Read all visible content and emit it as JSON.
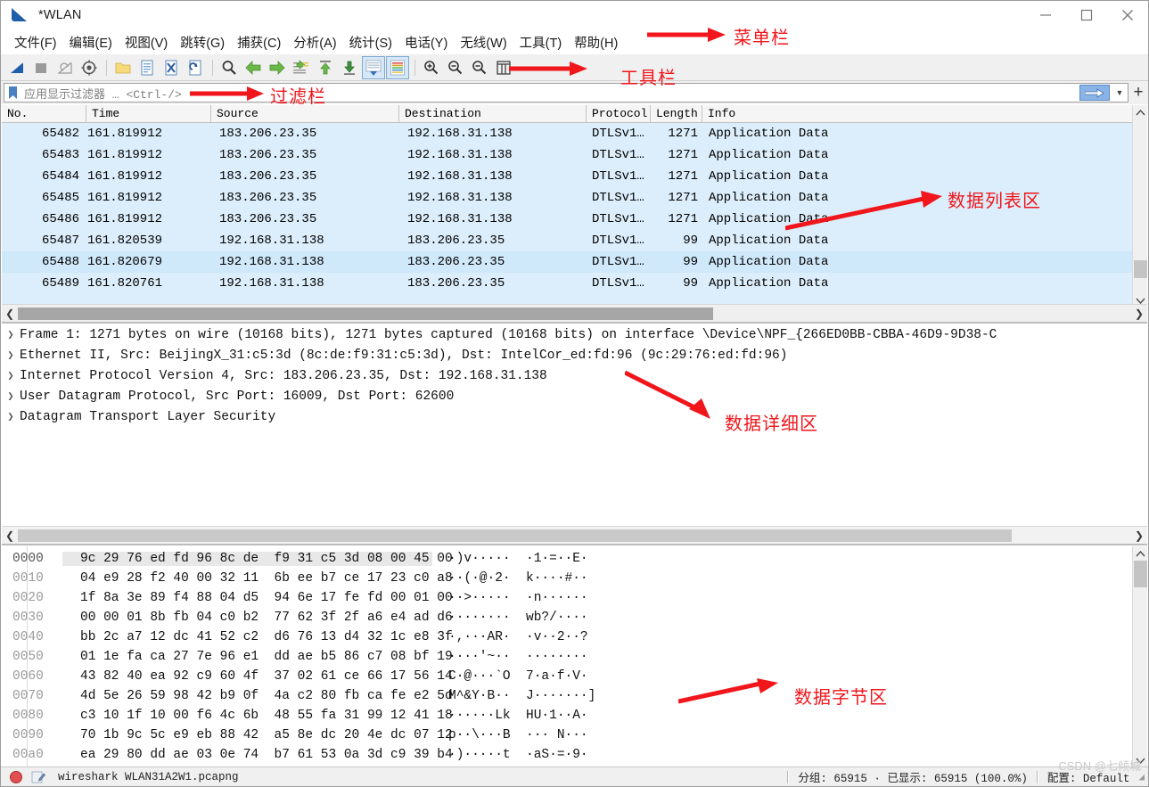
{
  "window": {
    "title": "*WLAN",
    "app_icon": "wireshark-fin-icon",
    "minimize": "minimize-icon",
    "maximize": "maximize-icon",
    "close": "close-icon"
  },
  "menu": {
    "items": [
      {
        "label": "文件(F)"
      },
      {
        "label": "编辑(E)"
      },
      {
        "label": "视图(V)"
      },
      {
        "label": "跳转(G)"
      },
      {
        "label": "捕获(C)"
      },
      {
        "label": "分析(A)"
      },
      {
        "label": "统计(S)"
      },
      {
        "label": "电话(Y)"
      },
      {
        "label": "无线(W)"
      },
      {
        "label": "工具(T)"
      },
      {
        "label": "帮助(H)"
      }
    ]
  },
  "toolbar": {
    "buttons": [
      {
        "name": "start-capture-icon"
      },
      {
        "name": "stop-capture-icon"
      },
      {
        "name": "restart-capture-icon"
      },
      {
        "name": "capture-options-icon"
      },
      {
        "name": "open-file-icon"
      },
      {
        "name": "save-file-icon"
      },
      {
        "name": "close-file-icon"
      },
      {
        "name": "reload-file-icon"
      },
      {
        "name": "find-packet-icon"
      },
      {
        "name": "go-back-icon"
      },
      {
        "name": "go-forward-icon"
      },
      {
        "name": "go-to-packet-icon"
      },
      {
        "name": "go-to-first-icon"
      },
      {
        "name": "go-to-last-icon"
      },
      {
        "name": "auto-scroll-icon"
      },
      {
        "name": "colorize-icon"
      },
      {
        "name": "zoom-in-icon"
      },
      {
        "name": "zoom-out-icon"
      },
      {
        "name": "zoom-reset-icon"
      },
      {
        "name": "resize-columns-icon"
      }
    ]
  },
  "filter": {
    "bookmark_icon": "bookmark-icon",
    "placeholder": "应用显示过滤器 … <Ctrl-/>",
    "value": "",
    "apply_icon": "apply-filter-arrow-icon",
    "dropdown_icon": "chevron-down-icon",
    "add_icon": "plus-icon"
  },
  "packet_list": {
    "columns": [
      "No.",
      "Time",
      "Source",
      "Destination",
      "Protocol",
      "Length",
      "Info"
    ],
    "rows": [
      {
        "no": "65482",
        "time": "161.819912",
        "source": "183.206.23.35",
        "destination": "192.168.31.138",
        "protocol": "DTLSv1…",
        "length": "1271",
        "info": "Application Data",
        "selected": false
      },
      {
        "no": "65483",
        "time": "161.819912",
        "source": "183.206.23.35",
        "destination": "192.168.31.138",
        "protocol": "DTLSv1…",
        "length": "1271",
        "info": "Application Data",
        "selected": false
      },
      {
        "no": "65484",
        "time": "161.819912",
        "source": "183.206.23.35",
        "destination": "192.168.31.138",
        "protocol": "DTLSv1…",
        "length": "1271",
        "info": "Application Data",
        "selected": false
      },
      {
        "no": "65485",
        "time": "161.819912",
        "source": "183.206.23.35",
        "destination": "192.168.31.138",
        "protocol": "DTLSv1…",
        "length": "1271",
        "info": "Application Data",
        "selected": false
      },
      {
        "no": "65486",
        "time": "161.819912",
        "source": "183.206.23.35",
        "destination": "192.168.31.138",
        "protocol": "DTLSv1…",
        "length": "1271",
        "info": "Application Data",
        "selected": false
      },
      {
        "no": "65487",
        "time": "161.820539",
        "source": "192.168.31.138",
        "destination": "183.206.23.35",
        "protocol": "DTLSv1…",
        "length": "99",
        "info": "Application Data",
        "selected": false
      },
      {
        "no": "65488",
        "time": "161.820679",
        "source": "192.168.31.138",
        "destination": "183.206.23.35",
        "protocol": "DTLSv1…",
        "length": "99",
        "info": "Application Data",
        "selected": true
      },
      {
        "no": "65489",
        "time": "161.820761",
        "source": "192.168.31.138",
        "destination": "183.206.23.35",
        "protocol": "DTLSv1…",
        "length": "99",
        "info": "Application Data",
        "selected": false
      }
    ]
  },
  "packet_details": {
    "rows": [
      {
        "text": "Frame 1: 1271 bytes on wire (10168 bits), 1271 bytes captured (10168 bits) on interface \\Device\\NPF_{266ED0BB-CBBA-46D9-9D38-C"
      },
      {
        "text": "Ethernet II, Src: BeijingX_31:c5:3d (8c:de:f9:31:c5:3d), Dst: IntelCor_ed:fd:96 (9c:29:76:ed:fd:96)"
      },
      {
        "text": "Internet Protocol Version 4, Src: 183.206.23.35, Dst: 192.168.31.138"
      },
      {
        "text": "User Datagram Protocol, Src Port: 16009, Dst Port: 62600"
      },
      {
        "text": "Datagram Transport Layer Security"
      }
    ]
  },
  "hex_dump": {
    "rows": [
      {
        "offset": "0000",
        "bytes": "9c 29 76 ed fd 96 8c de  f9 31 c5 3d 08 00 45 00",
        "ascii": "·)v·····  ·1·=··E·"
      },
      {
        "offset": "0010",
        "bytes": "04 e9 28 f2 40 00 32 11  6b ee b7 ce 17 23 c0 a8",
        "ascii": "··(·@·2·  k····#··"
      },
      {
        "offset": "0020",
        "bytes": "1f 8a 3e 89 f4 88 04 d5  94 6e 17 fe fd 00 01 00",
        "ascii": "··>·····  ·n······"
      },
      {
        "offset": "0030",
        "bytes": "00 00 01 8b fb 04 c0 b2  77 62 3f 2f a6 e4 ad d6",
        "ascii": "········  wb?/····"
      },
      {
        "offset": "0040",
        "bytes": "bb 2c a7 12 dc 41 52 c2  d6 76 13 d4 32 1c e8 3f",
        "ascii": "·,···AR·  ·v··2··?"
      },
      {
        "offset": "0050",
        "bytes": "01 1e fa ca 27 7e 96 e1  dd ae b5 86 c7 08 bf 19",
        "ascii": "····'~··  ········"
      },
      {
        "offset": "0060",
        "bytes": "43 82 40 ea 92 c9 60 4f  37 02 61 ce 66 17 56 14",
        "ascii": "C·@···`O  7·a·f·V·"
      },
      {
        "offset": "0070",
        "bytes": "4d 5e 26 59 98 42 b9 0f  4a c2 80 fb ca fe e2 5d",
        "ascii": "M^&Y·B··  J·······]"
      },
      {
        "offset": "0080",
        "bytes": "c3 10 1f 10 00 f6 4c 6b  48 55 fa 31 99 12 41 18",
        "ascii": "······Lk  HU·1··A·"
      },
      {
        "offset": "0090",
        "bytes": "70 1b 9c 5c e9 eb 88 42  a5 8e dc 20 4e dc 07 12",
        "ascii": "p··\\···B  ··· N···"
      },
      {
        "offset": "00a0",
        "bytes": "ea 29 80 dd ae 03 0e 74  b7 61 53 0a 3d c9 39 b4",
        "ascii": "·)·····t  ·aS·=·9·"
      }
    ]
  },
  "status_bar": {
    "record_icon": "record-dot-icon",
    "edit_icon": "edit-comment-icon",
    "file_name": "wireshark WLAN31A2W1.pcapng",
    "packets": "分组: 65915 · 已显示: 65915 (100.0%)",
    "profile": "配置: Default"
  },
  "annotations": [
    {
      "id": "menubar-label",
      "text": "菜单栏"
    },
    {
      "id": "toolbar-label",
      "text": "工具栏"
    },
    {
      "id": "filterbar-label",
      "text": "过滤栏"
    },
    {
      "id": "packet-list-label",
      "text": "数据列表区"
    },
    {
      "id": "packet-details-label",
      "text": "数据详细区"
    },
    {
      "id": "hex-label",
      "text": "数据字节区"
    }
  ],
  "watermark": {
    "text": "CSDN @七倾城"
  },
  "colors": {
    "annotation_red": "#f0161c",
    "packet_row_bg": "#dceefb",
    "packet_row_selected": "#cfe8fa",
    "toolbar_bg": "#f0f0f0"
  }
}
